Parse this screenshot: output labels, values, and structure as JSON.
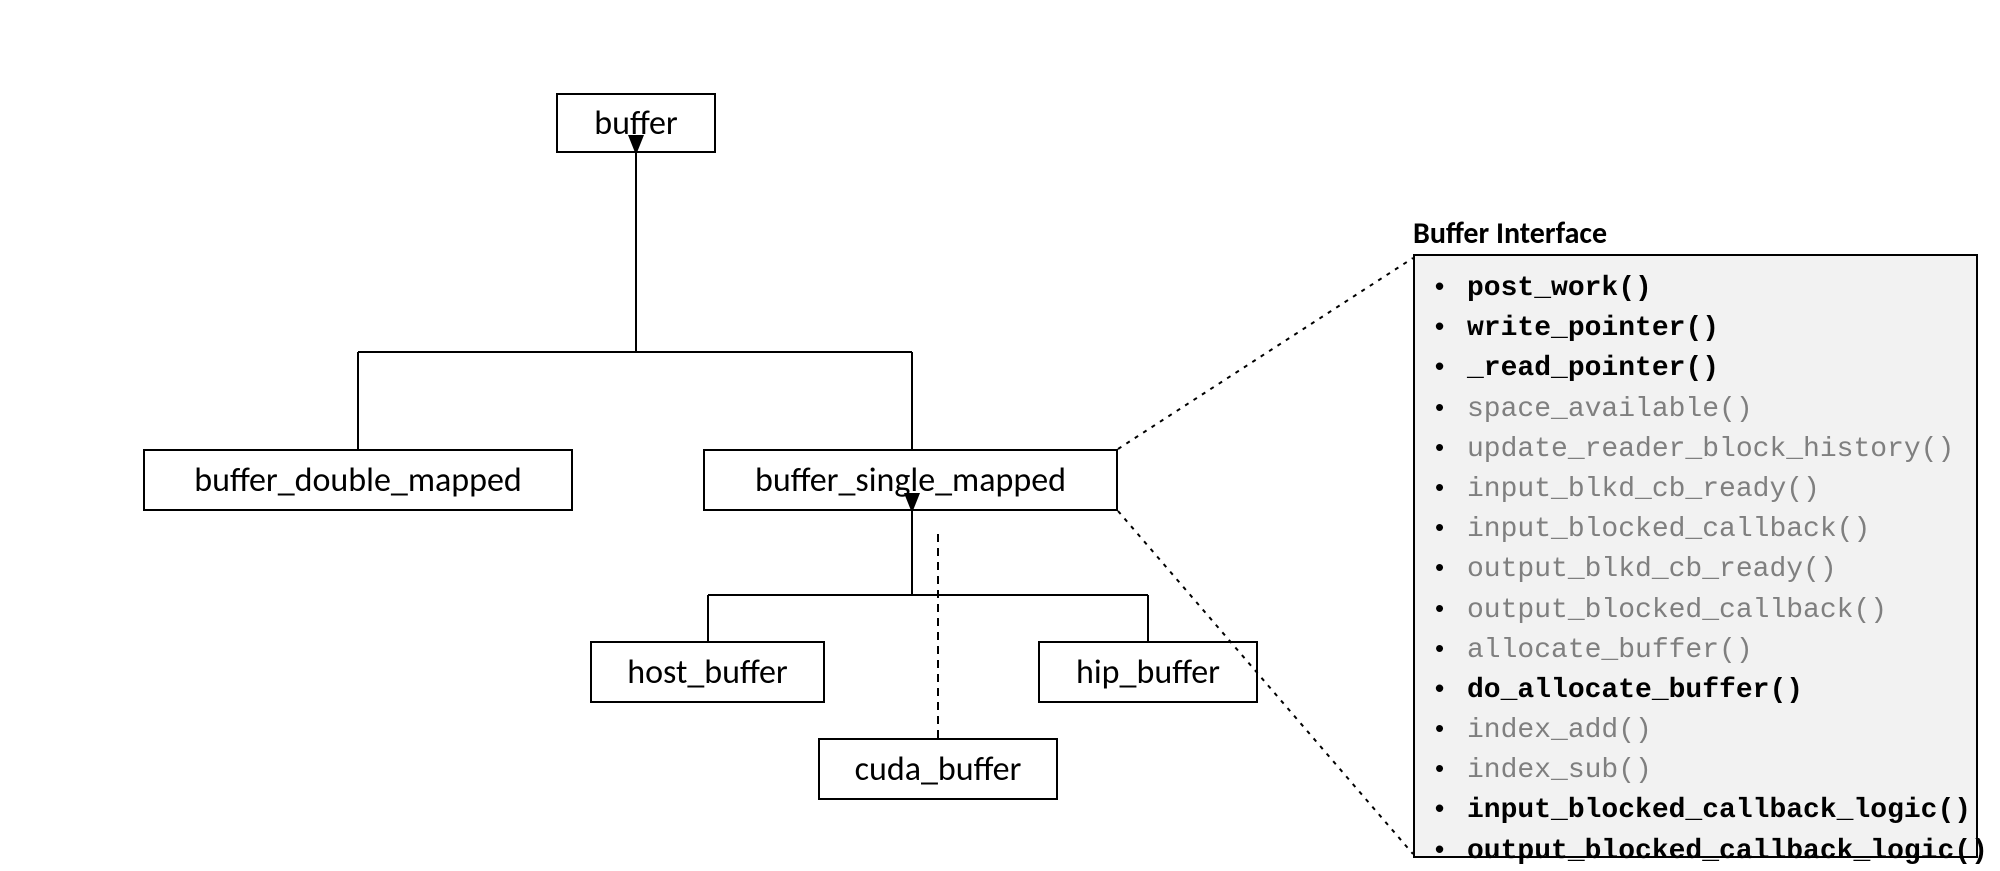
{
  "nodes": {
    "buffer": "buffer",
    "buffer_double_mapped": "buffer_double_mapped",
    "buffer_single_mapped": "buffer_single_mapped",
    "host_buffer": "host_buffer",
    "hip_buffer": "hip_buffer",
    "cuda_buffer": "cuda_buffer"
  },
  "panel": {
    "title": "Buffer Interface",
    "items": [
      {
        "label": "post_work()",
        "bold": true
      },
      {
        "label": "write_pointer()",
        "bold": true
      },
      {
        "label": "_read_pointer()",
        "bold": true
      },
      {
        "label": "space_available()",
        "bold": false
      },
      {
        "label": "update_reader_block_history()",
        "bold": false
      },
      {
        "label": "input_blkd_cb_ready()",
        "bold": false
      },
      {
        "label": "input_blocked_callback()",
        "bold": false
      },
      {
        "label": "output_blkd_cb_ready()",
        "bold": false
      },
      {
        "label": "output_blocked_callback()",
        "bold": false
      },
      {
        "label": "allocate_buffer()",
        "bold": false
      },
      {
        "label": "do_allocate_buffer()",
        "bold": true
      },
      {
        "label": "index_add()",
        "bold": false
      },
      {
        "label": "index_sub()",
        "bold": false
      },
      {
        "label": "input_blocked_callback_logic()",
        "bold": true
      },
      {
        "label": "output_blocked_callback_logic()",
        "bold": true
      }
    ]
  }
}
